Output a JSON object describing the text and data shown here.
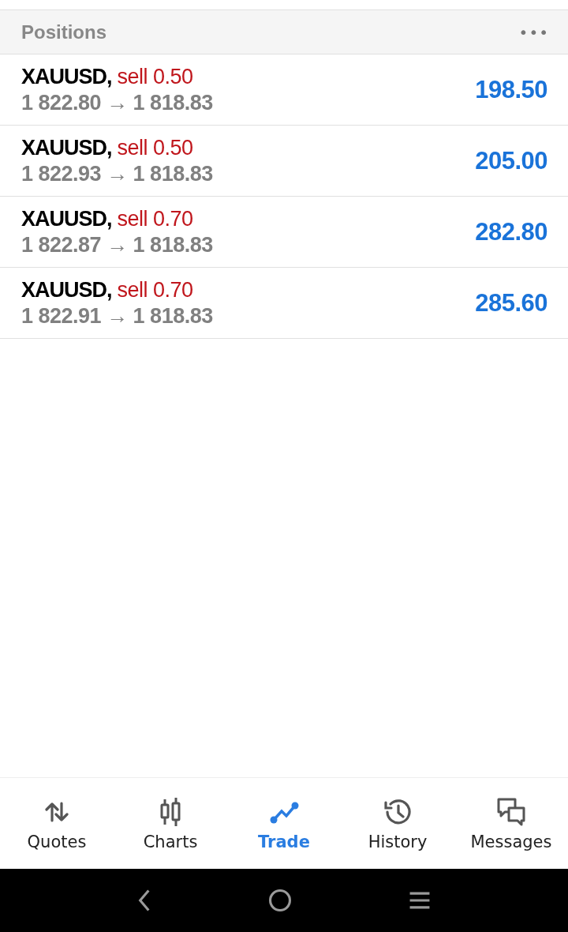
{
  "header": {
    "title": "Positions",
    "menu": "•••"
  },
  "positions": [
    {
      "symbol": "XAUUSD,",
      "side": "sell",
      "volume": "0.50",
      "open_price": "1 822.80",
      "arrow": "→",
      "current_price": "1 818.83",
      "profit": "198.50"
    },
    {
      "symbol": "XAUUSD,",
      "side": "sell",
      "volume": "0.50",
      "open_price": "1 822.93",
      "arrow": "→",
      "current_price": "1 818.83",
      "profit": "205.00"
    },
    {
      "symbol": "XAUUSD,",
      "side": "sell",
      "volume": "0.70",
      "open_price": "1 822.87",
      "arrow": "→",
      "current_price": "1 818.83",
      "profit": "282.80"
    },
    {
      "symbol": "XAUUSD,",
      "side": "sell",
      "volume": "0.70",
      "open_price": "1 822.91",
      "arrow": "→",
      "current_price": "1 818.83",
      "profit": "285.60"
    }
  ],
  "tabs": [
    {
      "label": "Quotes",
      "kind": "quotes",
      "selected": false
    },
    {
      "label": "Charts",
      "kind": "charts",
      "selected": false
    },
    {
      "label": "Trade",
      "kind": "trade",
      "selected": true
    },
    {
      "label": "History",
      "kind": "history",
      "selected": false
    },
    {
      "label": "Messages",
      "kind": "messages",
      "selected": false
    }
  ]
}
